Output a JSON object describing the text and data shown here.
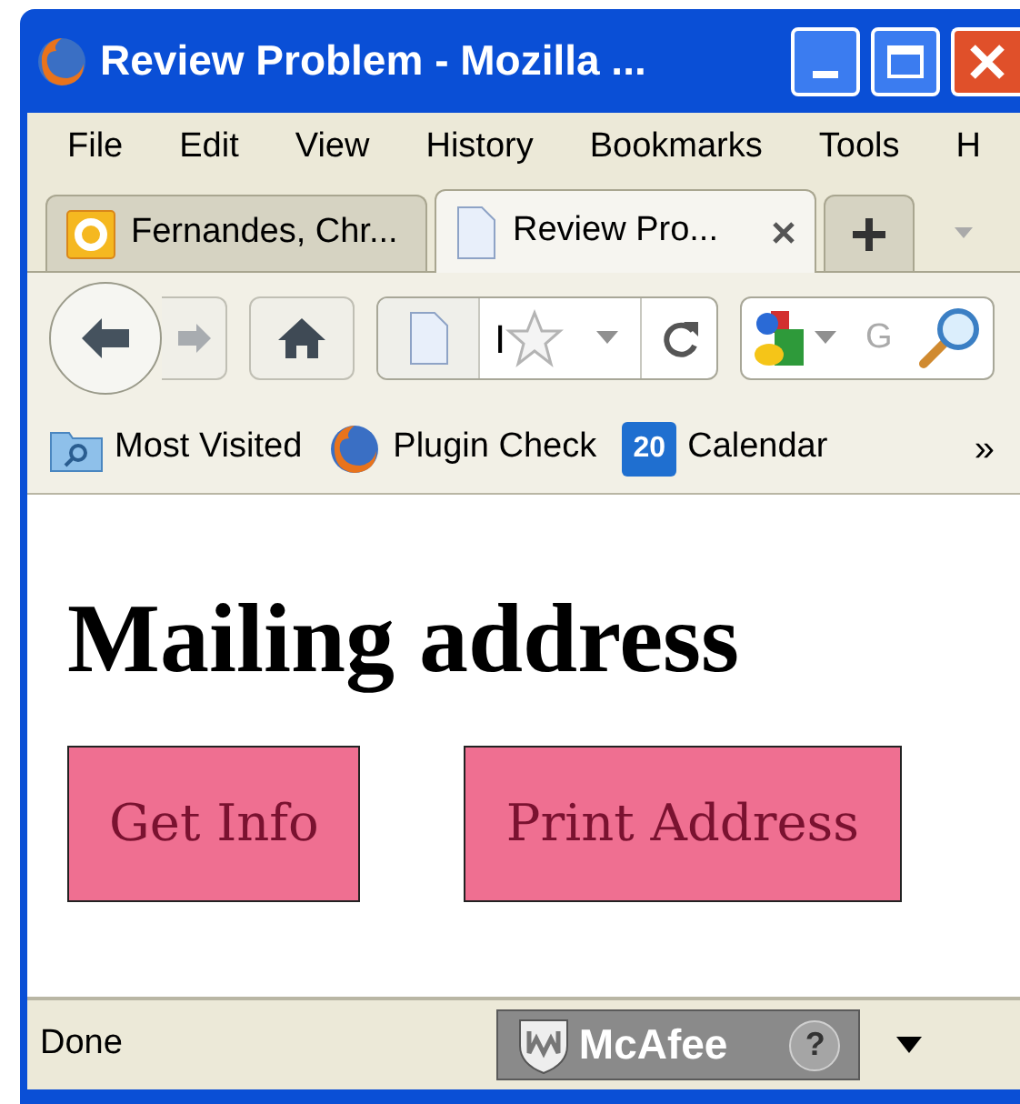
{
  "window": {
    "title": "Review Problem - Mozilla ..."
  },
  "menu": [
    {
      "label": "File"
    },
    {
      "label": "Edit"
    },
    {
      "label": "View"
    },
    {
      "label": "History"
    },
    {
      "label": "Bookmarks"
    },
    {
      "label": "Tools"
    },
    {
      "label": "H"
    }
  ],
  "tabs": [
    {
      "label": "Fernandes, Chr...",
      "kind": "mail",
      "selected": false
    },
    {
      "label": "Review Pro...",
      "kind": "page",
      "selected": true
    }
  ],
  "address_bar": {
    "value": "I"
  },
  "search_field": {
    "placeholder": "G"
  },
  "bookmarks": [
    {
      "label": "Most Visited",
      "kind": "folder"
    },
    {
      "label": "Plugin Check",
      "kind": "browser"
    },
    {
      "label": "Calendar",
      "kind": "calendar",
      "badge": "20"
    }
  ],
  "bookmarks_overflow": "»",
  "page": {
    "heading": "Mailing address",
    "buttons": [
      "Get Info",
      "Print Address"
    ]
  },
  "status_bar": {
    "text": "Done",
    "security_badge": "McAfee",
    "help": "?"
  }
}
